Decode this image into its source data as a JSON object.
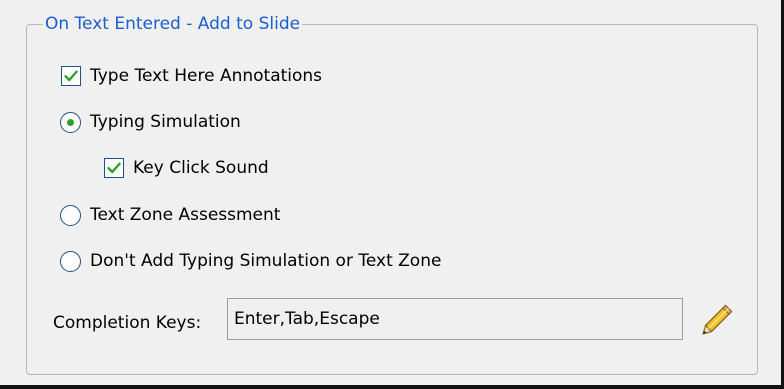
{
  "group": {
    "title": "On Text Entered - Add to Slide"
  },
  "options": {
    "type_text_annotations": {
      "label": "Type Text Here Annotations",
      "checked": true
    },
    "typing_simulation": {
      "label": "Typing Simulation",
      "selected": true
    },
    "key_click_sound": {
      "label": "Key Click Sound",
      "checked": true
    },
    "text_zone_assessment": {
      "label": "Text Zone Assessment",
      "selected": false
    },
    "dont_add": {
      "label": "Don't Add Typing Simulation or Text Zone",
      "selected": false
    }
  },
  "completion": {
    "label": "Completion Keys:",
    "value": "Enter,Tab,Escape"
  },
  "icons": {
    "edit": "pencil-icon"
  },
  "colors": {
    "legend_text": "#1a5fcf",
    "check_mark": "#2ba02b",
    "control_border": "#1d5281",
    "pencil_body": "#f2c230"
  }
}
